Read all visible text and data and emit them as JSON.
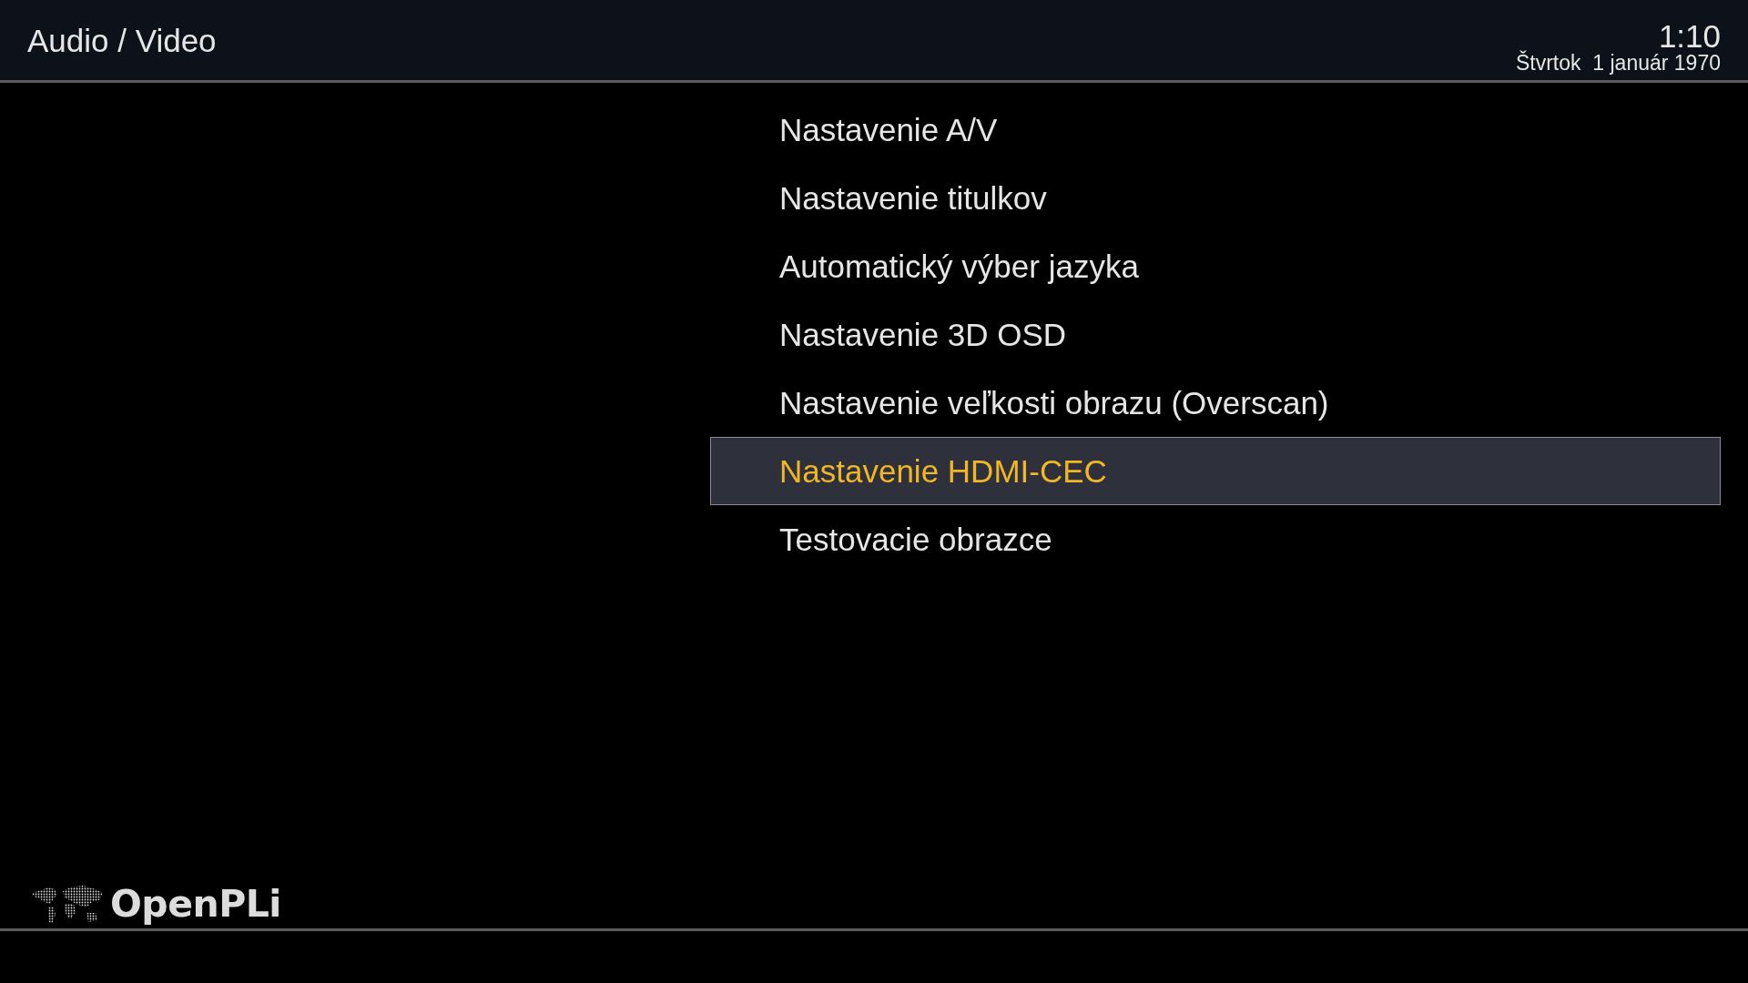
{
  "header": {
    "title": "Audio / Video",
    "time": "1:10",
    "date": "Štvrtok  1 január 1970"
  },
  "menu": {
    "items": [
      {
        "label": "Nastavenie A/V",
        "selected": false
      },
      {
        "label": "Nastavenie titulkov",
        "selected": false
      },
      {
        "label": "Automatický výber jazyka",
        "selected": false
      },
      {
        "label": "Nastavenie 3D OSD",
        "selected": false
      },
      {
        "label": "Nastavenie veľkosti obrazu (Overscan)",
        "selected": false
      },
      {
        "label": "Nastavenie HDMI-CEC",
        "selected": true
      },
      {
        "label": "Testovacie obrazce",
        "selected": false
      }
    ]
  },
  "footer": {
    "logo": "OpenPLi"
  }
}
